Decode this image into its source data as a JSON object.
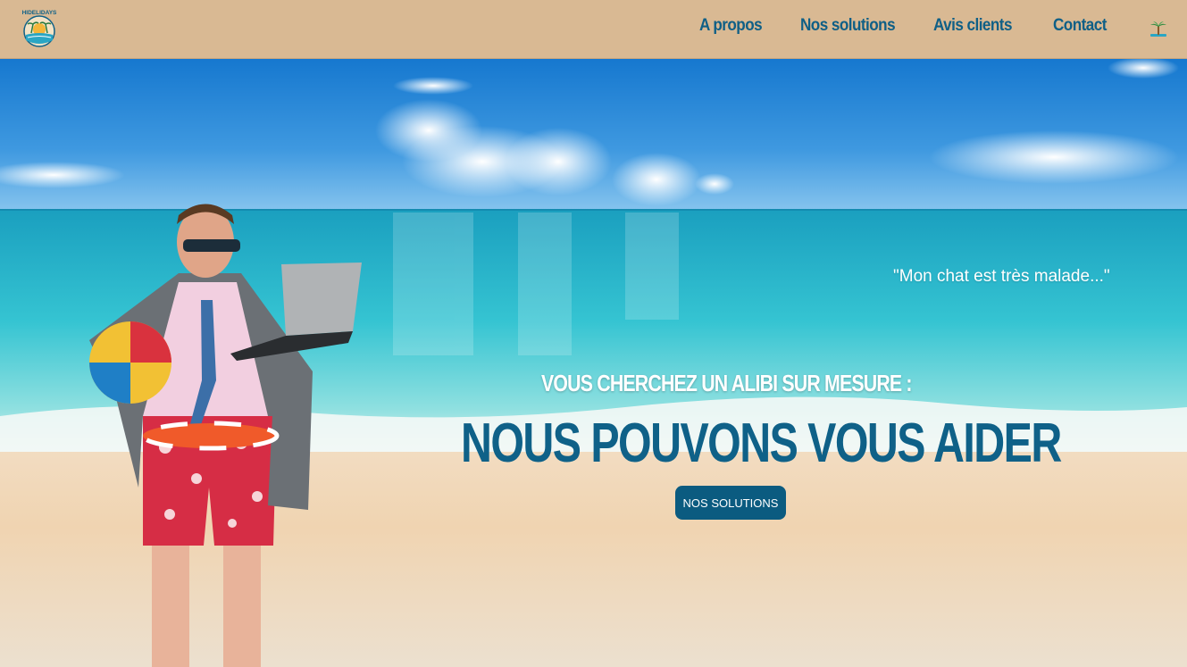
{
  "brand": {
    "logo_text": "HIDELIDAYS"
  },
  "nav": {
    "items": [
      {
        "label": "A propos"
      },
      {
        "label": "Nos solutions"
      },
      {
        "label": "Avis clients"
      },
      {
        "label": "Contact"
      }
    ],
    "end_icon": "palm-tree-icon"
  },
  "hero": {
    "quote": "\"Mon chat est très malade...\"",
    "subheadline": "VOUS CHERCHEZ UN ALIBI SUR MESURE :",
    "headline": "NOUS POUVONS VOUS AIDER",
    "cta_label": "NOS SOLUTIONS"
  },
  "colors": {
    "navbar_bg": "#d9b993",
    "brand_blue": "#0f6188",
    "button_bg": "#0b5b80",
    "text_light": "#ffffff"
  }
}
